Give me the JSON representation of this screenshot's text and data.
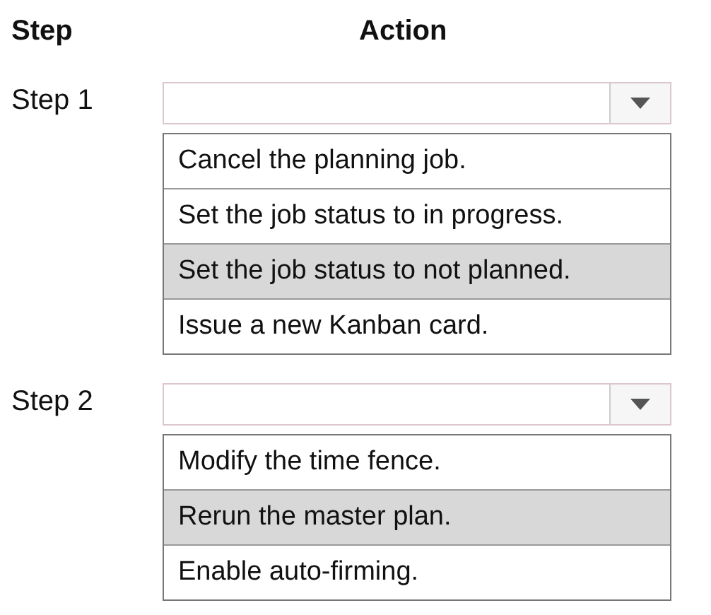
{
  "headers": {
    "step": "Step",
    "action": "Action"
  },
  "steps": [
    {
      "label": "Step 1",
      "options": [
        {
          "text": "Cancel the planning job.",
          "selected": false
        },
        {
          "text": "Set the job status to in progress.",
          "selected": false
        },
        {
          "text": "Set the job status to not planned.",
          "selected": true
        },
        {
          "text": "Issue a new Kanban card.",
          "selected": false
        }
      ]
    },
    {
      "label": "Step 2",
      "options": [
        {
          "text": "Modify the time fence.",
          "selected": false
        },
        {
          "text": "Rerun the master plan.",
          "selected": true
        },
        {
          "text": "Enable auto-firming.",
          "selected": false
        }
      ]
    }
  ]
}
